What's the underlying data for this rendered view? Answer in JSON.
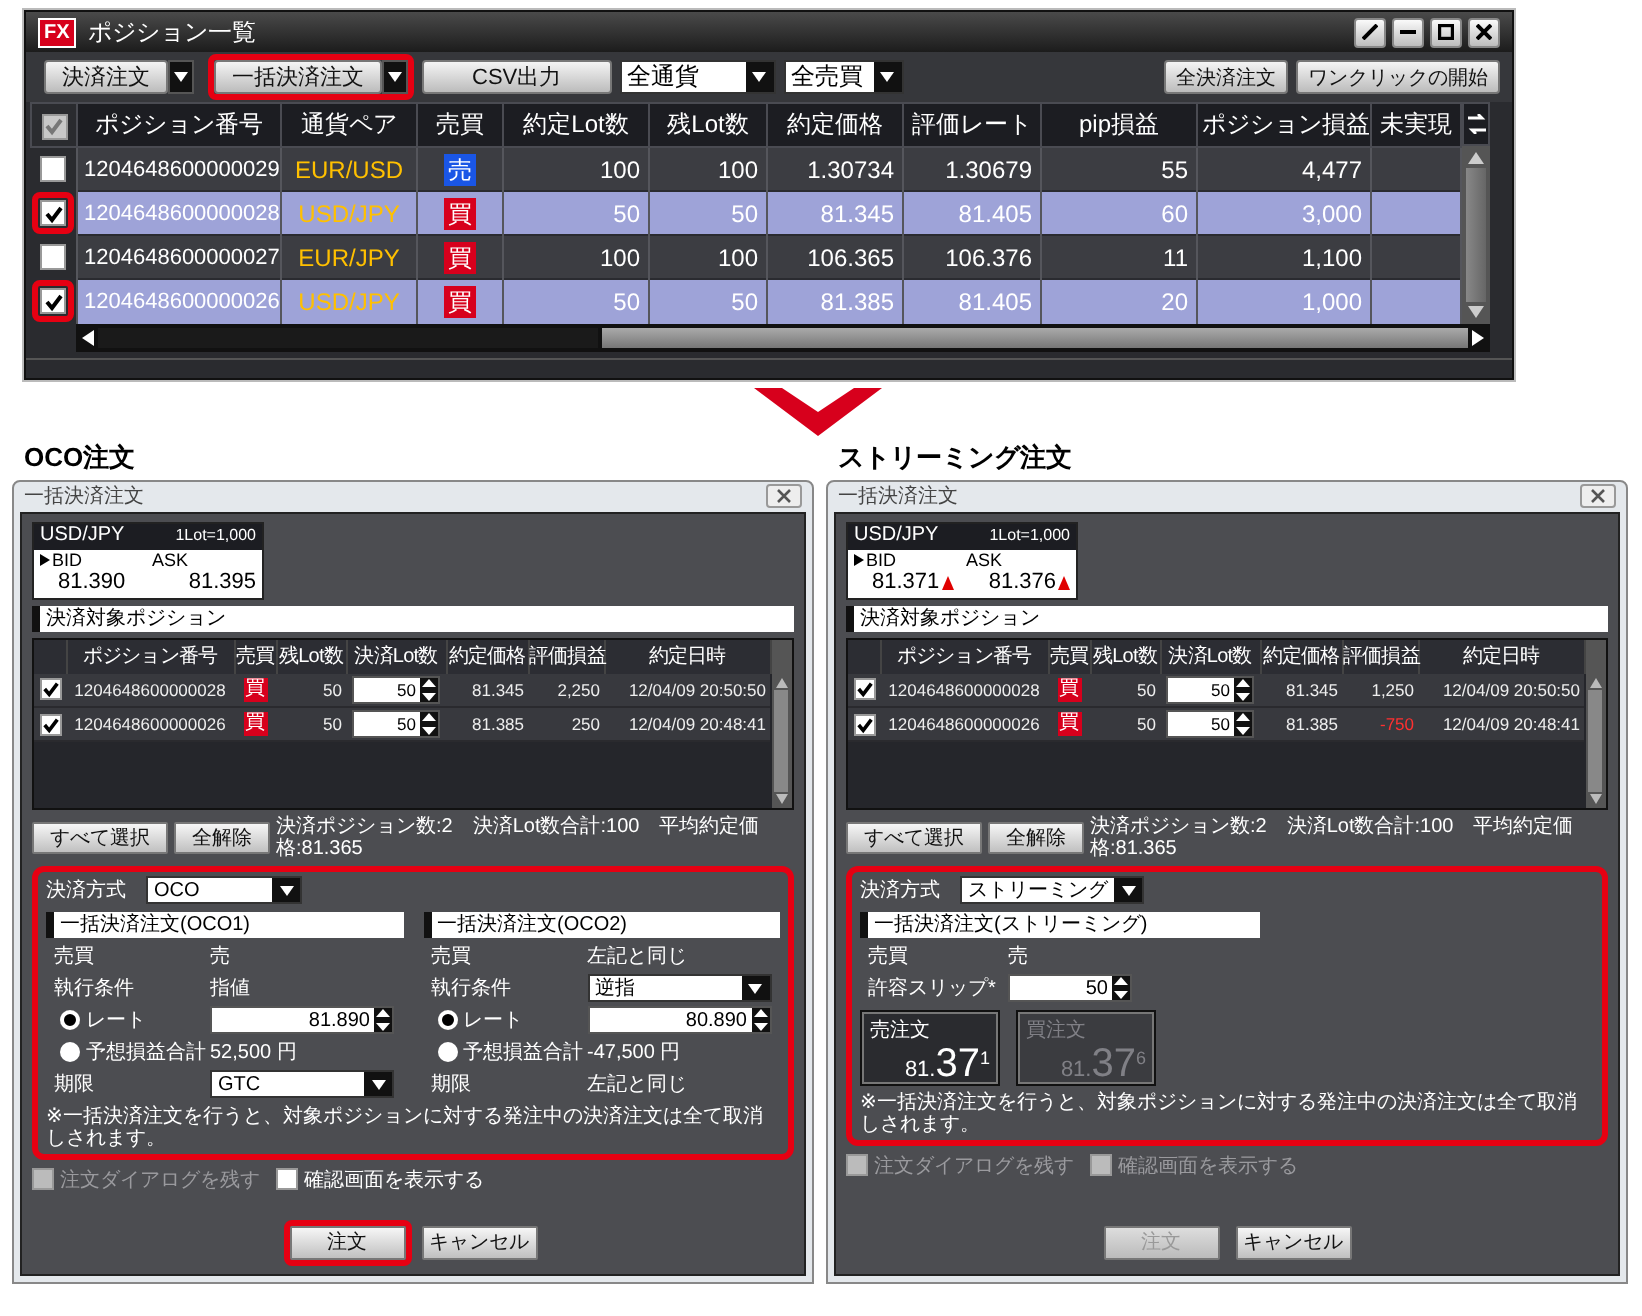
{
  "main_window": {
    "logo": "FX",
    "title": "ポジション一覧",
    "toolbar": [
      {
        "kind": "split",
        "label": "決済注文",
        "highlighted": false
      },
      {
        "kind": "split",
        "label": "一括決済注文",
        "highlighted": true
      },
      {
        "kind": "button",
        "label": "CSV出力"
      },
      {
        "kind": "select",
        "value": "全通貨"
      },
      {
        "kind": "select",
        "value": "全売買"
      }
    ],
    "toolbar_right": [
      "全決済注文",
      "ワンクリックの開始"
    ],
    "header_checkbox": {
      "checked": true,
      "disabled": true
    },
    "columns": [
      "ポジション番号",
      "通貨ペア",
      "売買",
      "約定Lot数",
      "残Lot数",
      "約定価格",
      "評価レート",
      "pip損益",
      "ポジション損益",
      "未実現"
    ],
    "rows": [
      {
        "checked": false,
        "selected": false,
        "highlighted": false,
        "number": "1204648600000029",
        "pair": "EUR/USD",
        "side": {
          "label": "売",
          "color": "#1a56e6"
        },
        "lot": "100",
        "remaining": "100",
        "price": "1.30734",
        "rate": "1.30679",
        "pip": "55",
        "pnl": "4,477"
      },
      {
        "checked": true,
        "selected": true,
        "highlighted": true,
        "number": "1204648600000028",
        "pair": "USD/JPY",
        "side": {
          "label": "買",
          "color": "#d7001c"
        },
        "lot": "50",
        "remaining": "50",
        "price": "81.345",
        "rate": "81.405",
        "pip": "60",
        "pnl": "3,000"
      },
      {
        "checked": false,
        "selected": false,
        "highlighted": false,
        "number": "1204648600000027",
        "pair": "EUR/JPY",
        "side": {
          "label": "買",
          "color": "#d7001c"
        },
        "lot": "100",
        "remaining": "100",
        "price": "106.365",
        "rate": "106.376",
        "pip": "11",
        "pnl": "1,100"
      },
      {
        "checked": true,
        "selected": true,
        "highlighted": true,
        "number": "1204648600000026",
        "pair": "USD/JPY",
        "side": {
          "label": "買",
          "color": "#d7001c"
        },
        "lot": "50",
        "remaining": "50",
        "price": "81.385",
        "rate": "81.405",
        "pip": "20",
        "pnl": "1,000"
      }
    ]
  },
  "dialogs": [
    {
      "heading": "OCO注文",
      "title": "一括決済注文",
      "quote": {
        "pair": "USD/JPY",
        "lot_unit": "1Lot=1,000",
        "bid_label": "BID",
        "ask_label": "ASK",
        "bid": "81.390",
        "ask": "81.395"
      },
      "section_title": "決済対象ポジション",
      "columns": [
        "ポジション番号",
        "売買",
        "残Lot数",
        "決済Lot数",
        "約定価格",
        "評価損益",
        "約定日時"
      ],
      "rows": [
        {
          "checked": true,
          "number": "1204648600000028",
          "side": {
            "label": "買",
            "color": "#d7001c"
          },
          "remaining": "50",
          "close_lot": "50",
          "price": "81.345",
          "pnl": "2,250",
          "pnl_negative": false,
          "time": "12/04/09 20:50:50"
        },
        {
          "checked": true,
          "number": "1204648600000026",
          "side": {
            "label": "買",
            "color": "#d7001c"
          },
          "remaining": "50",
          "close_lot": "50",
          "price": "81.385",
          "pnl": "250",
          "pnl_negative": false,
          "time": "12/04/09 20:48:41"
        }
      ],
      "select_all": "すべて選択",
      "clear_all": "全解除",
      "summary": "決済ポジション数:2　決済Lot数合計:100　平均約定価格:81.365",
      "settings": {
        "kind": "oco",
        "highlighted": true,
        "method_label": "決済方式",
        "method_value": "OCO",
        "orders": [
          {
            "title": "一括決済注文(OCO1)",
            "fields": [
              {
                "kind": "text",
                "label": "売買",
                "value": "売"
              },
              {
                "kind": "text",
                "label": "執行条件",
                "value": "指値"
              },
              {
                "kind": "radio_spin",
                "label": "レート",
                "selected": true,
                "value": "81.890"
              },
              {
                "kind": "radio_text",
                "label": "予想損益合計",
                "selected": false,
                "value": "52,500 円"
              },
              {
                "kind": "select",
                "label": "期限",
                "value": "GTC"
              }
            ]
          },
          {
            "title": "一括決済注文(OCO2)",
            "fields": [
              {
                "kind": "text",
                "label": "売買",
                "value": "左記と同じ"
              },
              {
                "kind": "select",
                "label": "執行条件",
                "value": "逆指"
              },
              {
                "kind": "radio_spin",
                "label": "レート",
                "selected": true,
                "value": "80.890"
              },
              {
                "kind": "radio_text",
                "label": "予想損益合計",
                "selected": false,
                "value": "-47,500 円"
              },
              {
                "kind": "text",
                "label": "期限",
                "value": "左記と同じ"
              }
            ]
          }
        ],
        "note": "※一括決済注文を行うと、対象ポジションに対する発注中の決済注文は全て取消しされます。"
      },
      "options": [
        {
          "label": "注文ダイアログを残す",
          "checked": false,
          "disabled": true
        },
        {
          "label": "確認画面を表示する",
          "checked": false,
          "disabled": false
        }
      ],
      "buttons": [
        {
          "label": "注文",
          "disabled": false,
          "highlighted": true
        },
        {
          "label": "キャンセル",
          "disabled": false,
          "highlighted": false
        }
      ]
    },
    {
      "heading": "ストリーミング注文",
      "title": "一括決済注文",
      "quote": {
        "pair": "USD/JPY",
        "lot_unit": "1Lot=1,000",
        "bid_label": "BID",
        "ask_label": "ASK",
        "bid": "81.371",
        "ask": "81.376",
        "bid_up": true,
        "ask_up": true
      },
      "section_title": "決済対象ポジション",
      "columns": [
        "ポジション番号",
        "売買",
        "残Lot数",
        "決済Lot数",
        "約定価格",
        "評価損益",
        "約定日時"
      ],
      "rows": [
        {
          "checked": true,
          "number": "1204648600000028",
          "side": {
            "label": "買",
            "color": "#d7001c"
          },
          "remaining": "50",
          "close_lot": "50",
          "price": "81.345",
          "pnl": "1,250",
          "pnl_negative": false,
          "time": "12/04/09 20:50:50"
        },
        {
          "checked": true,
          "number": "1204648600000026",
          "side": {
            "label": "買",
            "color": "#d7001c"
          },
          "remaining": "50",
          "close_lot": "50",
          "price": "81.385",
          "pnl": "-750",
          "pnl_negative": true,
          "time": "12/04/09 20:48:41"
        }
      ],
      "select_all": "すべて選択",
      "clear_all": "全解除",
      "summary": "決済ポジション数:2　決済Lot数合計:100　平均約定価格:81.365",
      "settings": {
        "kind": "streaming",
        "highlighted": true,
        "method_label": "決済方式",
        "method_value": "ストリーミング",
        "orders": [
          {
            "title": "一括決済注文(ストリーミング)",
            "fields": [
              {
                "kind": "text",
                "label": "売買",
                "value": "売"
              },
              {
                "kind": "spin",
                "label": "許容スリップ*",
                "value": "50"
              }
            ]
          }
        ],
        "tiles": [
          {
            "label": "売注文",
            "small": "81.",
            "large": "37",
            "sup": "1",
            "active": true
          },
          {
            "label": "買注文",
            "small": "81.",
            "large": "37",
            "sup": "6",
            "active": false
          }
        ],
        "note": "※一括決済注文を行うと、対象ポジションに対する発注中の決済注文は全て取消しされます。"
      },
      "options": [
        {
          "label": "注文ダイアログを残す",
          "checked": false,
          "disabled": true
        },
        {
          "label": "確認画面を表示する",
          "checked": false,
          "disabled": true
        }
      ],
      "buttons": [
        {
          "label": "注文",
          "disabled": true,
          "highlighted": false
        },
        {
          "label": "キャンセル",
          "disabled": false,
          "highlighted": false
        }
      ]
    }
  ]
}
